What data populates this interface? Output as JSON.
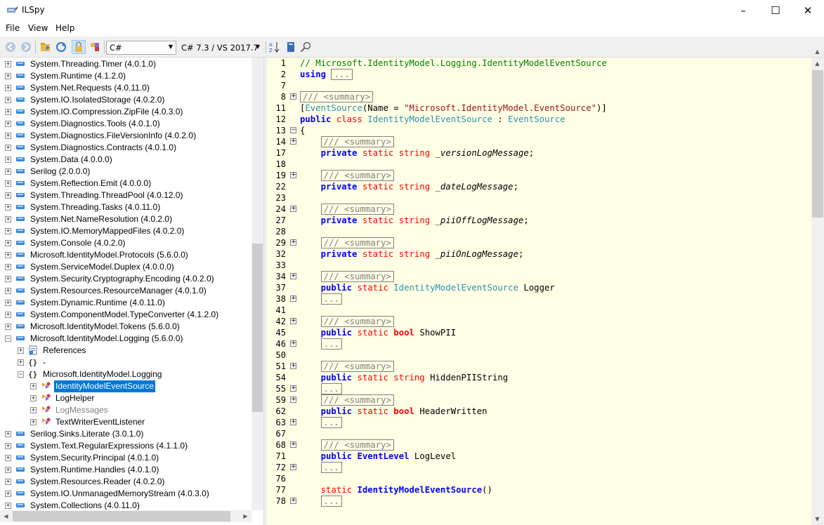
{
  "window": {
    "title": "ILSpy"
  },
  "menu": {
    "file": "File",
    "view": "View",
    "help": "Help"
  },
  "toolbar": {
    "language": "C#",
    "version": "C# 7.3 / VS 2017.7"
  },
  "tree": {
    "items": [
      {
        "label": "System.Threading.Timer (4.0.1.0)"
      },
      {
        "label": "System.Runtime (4.1.2.0)"
      },
      {
        "label": "System.Net.Requests (4.0.11.0)"
      },
      {
        "label": "System.IO.IsolatedStorage (4.0.2.0)"
      },
      {
        "label": "System.IO.Compression.ZipFile (4.0.3.0)"
      },
      {
        "label": "System.Diagnostics.Tools (4.0.1.0)"
      },
      {
        "label": "System.Diagnostics.FileVersionInfo (4.0.2.0)"
      },
      {
        "label": "System.Diagnostics.Contracts (4.0.1.0)"
      },
      {
        "label": "System.Data (4.0.0.0)"
      },
      {
        "label": "Serilog (2.0.0.0)"
      },
      {
        "label": "System.Reflection.Emit (4.0.0.0)"
      },
      {
        "label": "System.Threading.ThreadPool (4.0.12.0)"
      },
      {
        "label": "System.Threading.Tasks (4.0.11.0)"
      },
      {
        "label": "System.Net.NameResolution (4.0.2.0)"
      },
      {
        "label": "System.IO.MemoryMappedFiles (4.0.2.0)"
      },
      {
        "label": "System.Console (4.0.2.0)"
      },
      {
        "label": "Microsoft.IdentityModel.Protocols (5.6.0.0)"
      },
      {
        "label": "System.ServiceModel.Duplex (4.0.0.0)"
      },
      {
        "label": "System.Security.Cryptography.Encoding (4.0.2.0)"
      },
      {
        "label": "System.Resources.ResourceManager (4.0.1.0)"
      },
      {
        "label": "System.Dynamic.Runtime (4.0.11.0)"
      },
      {
        "label": "System.ComponentModel.TypeConverter (4.1.2.0)"
      },
      {
        "label": "Microsoft.IdentityModel.Tokens (5.6.0.0)"
      },
      {
        "label": "Microsoft.IdentityModel.Logging (5.6.0.0)"
      },
      {
        "label": "References"
      },
      {
        "label": "-"
      },
      {
        "label": "Microsoft.IdentityModel.Logging"
      },
      {
        "label": "IdentityModelEventSource"
      },
      {
        "label": "LogHelper"
      },
      {
        "label": "LogMessages"
      },
      {
        "label": "TextWriterEventListener"
      },
      {
        "label": "Serilog.Sinks.Literate (3.0.1.0)"
      },
      {
        "label": "System.Text.RegularExpressions (4.1.1.0)"
      },
      {
        "label": "System.Security.Principal (4.0.1.0)"
      },
      {
        "label": "System.Runtime.Handles (4.0.1.0)"
      },
      {
        "label": "System.Resources.Reader (4.0.2.0)"
      },
      {
        "label": "System.IO.UnmanagedMemoryStream (4.0.3.0)"
      },
      {
        "label": "System.Collections (4.0.11.0)"
      }
    ]
  },
  "code": {
    "ln": [
      "1",
      "2",
      "7",
      "8",
      "11",
      "12",
      "13",
      "14",
      "17",
      "18",
      "19",
      "22",
      "23",
      "24",
      "27",
      "28",
      "29",
      "32",
      "33",
      "34",
      "37",
      "38",
      "41",
      "42",
      "45",
      "46",
      "50",
      "51",
      "54",
      "55",
      "59",
      "62",
      "63",
      "67",
      "68",
      "71",
      "72",
      "76",
      "77",
      "78"
    ],
    "comment1": "// Microsoft.IdentityModel.Logging.IdentityModelEventSource",
    "using": "using",
    "ellipsis": "...",
    "summary": "/// <summary>",
    "attr_open": "[",
    "attr_name": "EventSource",
    "attr_mid": "(Name = ",
    "attr_str": "\"Microsoft.IdentityModel.EventSource\"",
    "attr_close": ")]",
    "public": "public",
    "class": "class",
    "classname": "IdentityModelEventSource",
    "colon": " : ",
    "base": "EventSource",
    "brace": "{",
    "private": "private",
    "static": "static",
    "string": "string",
    "bool": "bool",
    "f1": "_versionLogMessage",
    "f2": "_dateLogMessage",
    "f3": "_piiOffLogMessage",
    "f4": "_piiOnLogMessage",
    "semi": ";",
    "logger_type": "IdentityModelEventSource",
    "logger": "Logger",
    "showpii": "ShowPII",
    "hidden": "HiddenPIIString",
    "header": "HeaderWritten",
    "eventlevel": "EventLevel",
    "loglevel": "LogLevel",
    "ctor": "IdentityModelEventSource",
    "parens": "()"
  }
}
